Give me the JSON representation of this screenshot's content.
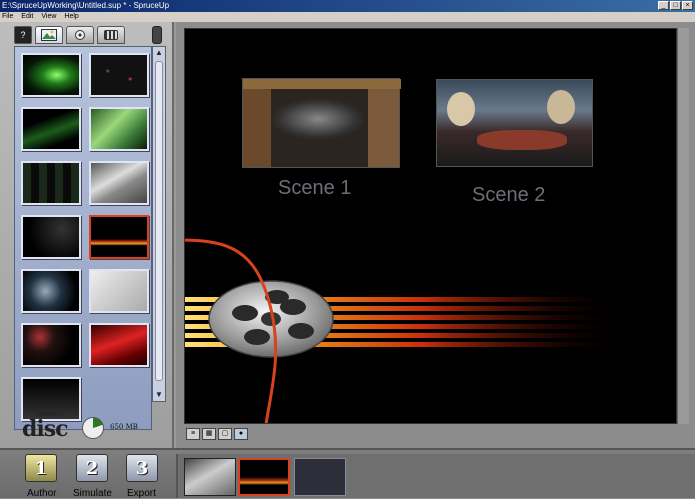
{
  "window": {
    "title": "E:\\SpruceUpWorking\\Untitled.sup * - SpruceUp",
    "controls": [
      "_",
      "□",
      "×"
    ]
  },
  "menu": [
    "File",
    "Edit",
    "View",
    "Help"
  ],
  "left_panel": {
    "tabs": [
      "help-tab",
      "backgrounds-tab",
      "buttons-tab",
      "video-tab"
    ],
    "help_label": "?",
    "scroll_up": "▲",
    "scroll_down": "▼",
    "disc": {
      "logo_small": "COMPACT",
      "logo": "disc",
      "size": "650 MB"
    }
  },
  "preview": {
    "scenes": [
      {
        "label": "Scene 1"
      },
      {
        "label": "Scene 2"
      }
    ]
  },
  "bottom": {
    "modes": [
      {
        "number": "1",
        "label": "Author"
      },
      {
        "number": "2",
        "label": "Simulate"
      },
      {
        "number": "3",
        "label": "Export"
      }
    ]
  },
  "colors": {
    "accent_arrow": "#d8421c",
    "preview_bg": "#000000",
    "scene_text": "#6d6f77"
  }
}
